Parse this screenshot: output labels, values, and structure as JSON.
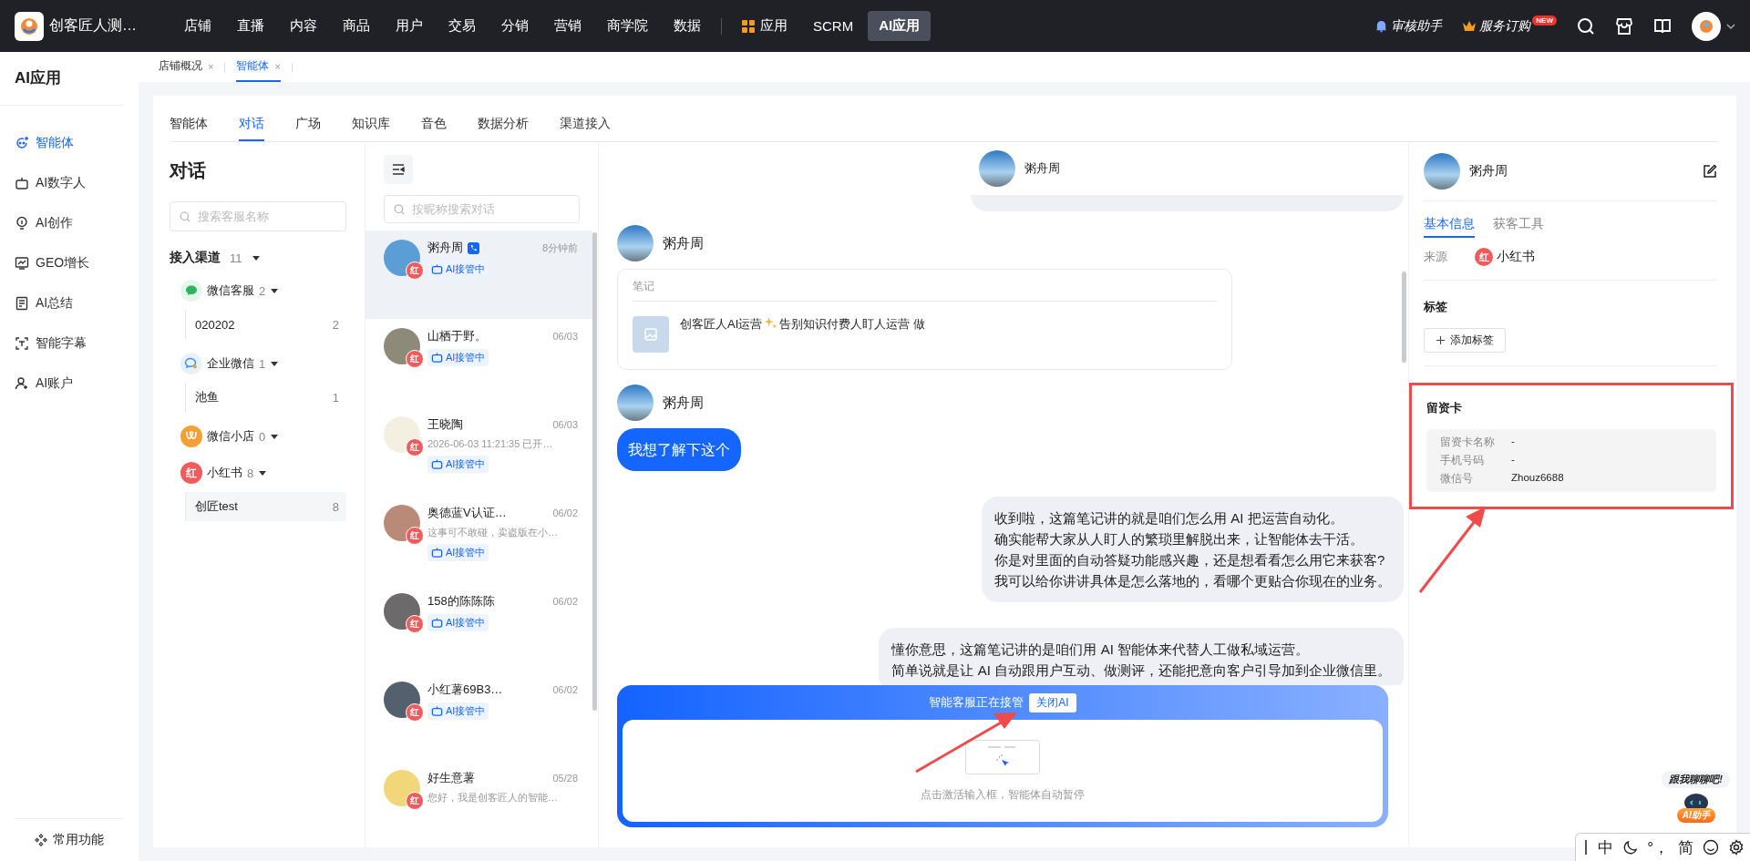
{
  "topbar": {
    "brand": "创客匠人测…",
    "nav": [
      {
        "label": "店铺",
        "kind": "link",
        "selected": false
      },
      {
        "label": "直播",
        "kind": "link",
        "selected": false
      },
      {
        "label": "内容",
        "kind": "link",
        "selected": false
      },
      {
        "label": "商品",
        "kind": "link",
        "selected": false
      },
      {
        "label": "用户",
        "kind": "link",
        "selected": false
      },
      {
        "label": "交易",
        "kind": "link",
        "selected": false
      },
      {
        "label": "分销",
        "kind": "link",
        "selected": false
      },
      {
        "label": "营销",
        "kind": "link",
        "selected": false
      },
      {
        "label": "商学院",
        "kind": "link",
        "selected": false
      },
      {
        "label": "数据",
        "kind": "link",
        "selected": false
      },
      {
        "label": "应用",
        "kind": "apps",
        "selected": false
      },
      {
        "label": "SCRM",
        "kind": "link",
        "selected": false
      },
      {
        "label": "AI应用",
        "kind": "link",
        "selected": true
      }
    ],
    "tools": [
      {
        "label": "审核助手",
        "kind": "bell"
      },
      {
        "label": "服务订购",
        "kind": "crown",
        "badge": "NEW"
      }
    ]
  },
  "sidebar": {
    "title": "AI应用",
    "items": [
      {
        "label": "智能体",
        "selected": true
      },
      {
        "label": "AI数字人",
        "selected": false
      },
      {
        "label": "AI创作",
        "selected": false
      },
      {
        "label": "GEO增长",
        "selected": false
      },
      {
        "label": "AI总结",
        "selected": false
      },
      {
        "label": "智能字幕",
        "selected": false
      },
      {
        "label": "AI账户",
        "selected": false
      }
    ],
    "footer": "常用功能"
  },
  "page_tabs": [
    {
      "label": "店铺概况",
      "close": "×",
      "selected": false
    },
    {
      "label": "智能体",
      "close": "×",
      "selected": true
    }
  ],
  "tabs": [
    {
      "label": "智能体",
      "selected": false
    },
    {
      "label": "对话",
      "selected": true
    },
    {
      "label": "广场",
      "selected": false
    },
    {
      "label": "知识库",
      "selected": false
    },
    {
      "label": "音色",
      "selected": false
    },
    {
      "label": "数据分析",
      "selected": false
    },
    {
      "label": "渠道接入",
      "selected": false
    }
  ],
  "channels": {
    "title": "对话",
    "search_placeholder": "搜索客服名称",
    "header": "接入渠道",
    "total": "11",
    "groups": [
      {
        "name": "微信客服",
        "kind": "wechat",
        "count": "2",
        "expanded": true,
        "children": [
          {
            "name": "020202",
            "count": "2",
            "selected": false
          }
        ]
      },
      {
        "name": "企业微信",
        "kind": "wecom",
        "count": "1",
        "expanded": true,
        "children": [
          {
            "name": "池鱼",
            "count": "1",
            "selected": false
          }
        ]
      },
      {
        "name": "微信小店",
        "kind": "shop",
        "count": "0",
        "expanded": true
      },
      {
        "name": "小红书",
        "kind": "redbook",
        "mark": "红",
        "count": "8",
        "expanded": true,
        "children": [
          {
            "name": "创匠test",
            "count": "8",
            "selected": true
          }
        ]
      }
    ]
  },
  "conversations": {
    "search_placeholder": "按昵称搜索对话",
    "items": [
      {
        "name": "粥舟周",
        "phone": true,
        "time": "8分钟前",
        "platform": "红",
        "tag": "AI接管中",
        "selected": true
      },
      {
        "name": "山栖于野。",
        "phone": false,
        "time": "06/03",
        "platform": "红",
        "tag": "AI接管中",
        "selected": false
      },
      {
        "name": "王晓陶",
        "phone": false,
        "time": "06/03",
        "preview": "2026-06-03 11:21:35 已开…",
        "platform": "红",
        "tag": "AI接管中",
        "selected": false
      },
      {
        "name": "奥德蓝V认证…",
        "phone": false,
        "time": "06/02",
        "preview": "这事可不敢碰，卖盗版在小…",
        "platform": "红",
        "tag": "AI接管中",
        "selected": false
      },
      {
        "name": "158的陈陈陈",
        "phone": false,
        "time": "06/02",
        "platform": "红",
        "tag": "AI接管中",
        "selected": false
      },
      {
        "name": "小红薯69B3…",
        "phone": false,
        "time": "06/02",
        "platform": "红",
        "tag": "AI接管中",
        "selected": false
      },
      {
        "name": "好生意薯",
        "phone": false,
        "time": "05/28",
        "preview": "您好，我是创客匠人的智能…",
        "platform": "红",
        "selected": false
      }
    ]
  },
  "chat": {
    "name": "粥舟周",
    "messages": [
      {
        "kind": "partial"
      },
      {
        "kind": "note",
        "sender": "粥舟周",
        "label": "笔记",
        "title": "创客匠人AI运营",
        "title_after": "告别知识付费人盯人运营 做"
      },
      {
        "kind": "incoming",
        "sender": "粥舟周",
        "lines": [
          "我想了解下这个"
        ]
      },
      {
        "kind": "outgoing",
        "lines": [
          "收到啦，这篇笔记讲的就是咱们怎么用 AI 把运营自动化。",
          "确实能帮大家从人盯人的繁琐里解脱出来，让智能体去干活。",
          "你是对里面的自动答疑功能感兴趣，还是想看看怎么用它来获客?",
          "我可以给你讲讲具体是怎么落地的，看哪个更贴合你现在的业务。"
        ]
      },
      {
        "kind": "outgoing",
        "lines": [
          "懂你意思，这篇笔记讲的是咱们用 AI 智能体来代替人工做私域运营。",
          "简单说就是让 AI 自动跟用户互动、做测评，还能把意向客户引导加到企业微信里。"
        ]
      }
    ],
    "takeover": {
      "status": "智能客服正在接管",
      "button": "关闭AI",
      "hint": "点击激活输入框，智能体自动暂停"
    }
  },
  "profile": {
    "name": "粥舟周",
    "tabs": [
      {
        "label": "基本信息",
        "selected": true
      },
      {
        "label": "获客工具",
        "selected": false
      }
    ],
    "source_label": "来源",
    "source_mark": "红",
    "source": "小红书",
    "tags_title": "标签",
    "add_tag": "添加标签",
    "lead_card": {
      "title": "留资卡",
      "highlighted": true,
      "fields": [
        {
          "label": "留资卡名称",
          "value": "-"
        },
        {
          "label": "手机号码",
          "value": "-"
        },
        {
          "label": "微信号",
          "value": "Zhouz6688"
        }
      ]
    }
  },
  "assistant": {
    "bubble": "跟我聊聊吧!",
    "badge": "AI助手"
  },
  "ime_bar": {
    "items": [
      "中",
      "°，",
      "简"
    ]
  }
}
